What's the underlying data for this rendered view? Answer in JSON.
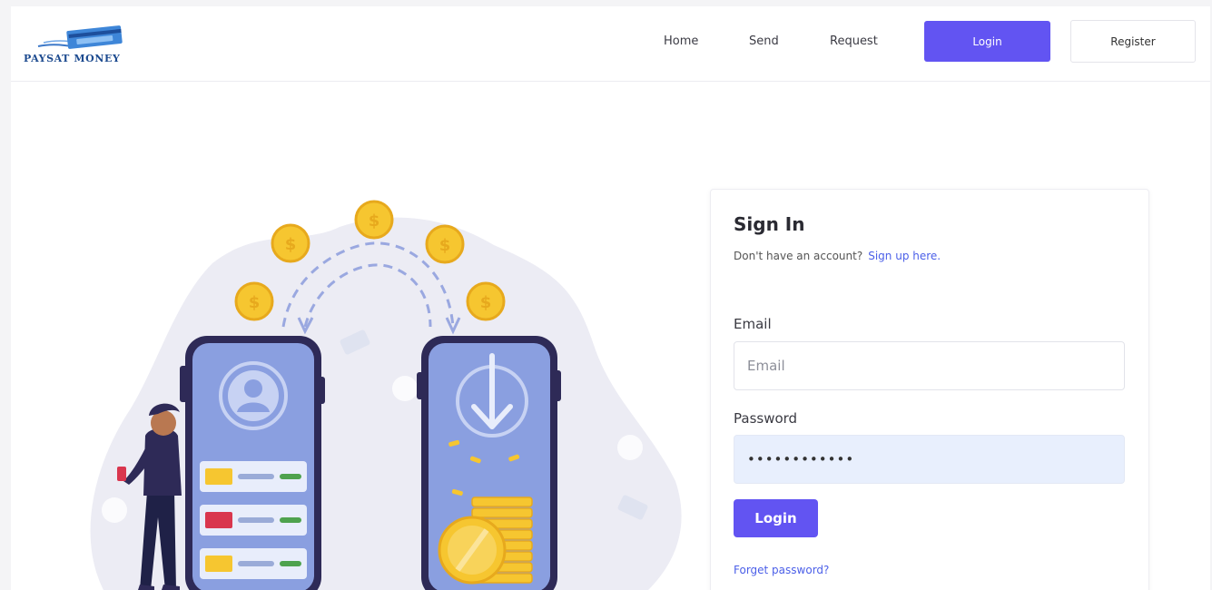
{
  "brand": {
    "name": "PAYSAT MONEY"
  },
  "nav": {
    "home": "Home",
    "send": "Send",
    "request": "Request",
    "login": "Login",
    "register": "Register"
  },
  "signin": {
    "title": "Sign In",
    "no_account": "Don't have an account?",
    "signup_link": "Sign up here.",
    "email_label": "Email",
    "email_placeholder": "Email",
    "email_value": "",
    "password_label": "Password",
    "password_value": "••••••••••••",
    "login_button": "Login",
    "forgot": "Forget password?"
  },
  "colors": {
    "accent": "#6254f2",
    "link": "#4b5fe8",
    "coin": "#f6c630",
    "phone_frame": "#2e2a57",
    "phone_screen": "#8a9fe0",
    "blob": "#ececf4"
  },
  "icons": [
    "wallet-card-logo-icon",
    "coin-icon",
    "user-avatar-icon",
    "download-arrow-icon",
    "credit-card-icon",
    "person-icon"
  ]
}
